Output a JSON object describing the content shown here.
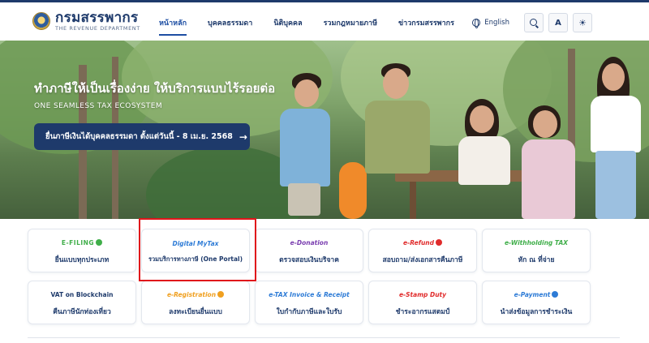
{
  "header": {
    "logo_th": "กรมสรรพากร",
    "logo_en": "THE REVENUE DEPARTMENT",
    "nav": [
      {
        "label": "หน้าหลัก",
        "active": true
      },
      {
        "label": "บุคคลธรรมดา",
        "active": false
      },
      {
        "label": "นิติบุคคล",
        "active": false
      },
      {
        "label": "รวมกฎหมายภาษี",
        "active": false
      },
      {
        "label": "ข่าวกรมสรรพากร",
        "active": false
      }
    ],
    "language": "English",
    "font_size_button": "A",
    "icons": {
      "language": "globe-icon",
      "search": "search-icon",
      "theme": "sun-icon"
    }
  },
  "hero": {
    "title": "ทำภาษีให้เป็นเรื่องง่าย ให้บริการแบบไร้รอยต่อ",
    "subtitle": "ONE SEAMLESS TAX ECOSYSTEM",
    "cta": "ยื่นภาษีเงินได้บุคคลธรรมดา ตั้งแต่วันนี้ - 8 เม.ย. 2568"
  },
  "services": [
    {
      "logo": "E-FILING",
      "label": "ยื่นแบบทุกประเภท",
      "accent": "#3fae49"
    },
    {
      "logo": "Digital MyTax",
      "label": "รวมบริการทางภาษี (One Portal)",
      "accent": "#2d7bd6",
      "highlighted": true
    },
    {
      "logo": "e-Donation",
      "label": "ตรวจสอบเงินบริจาค",
      "accent": "#7b3fb0"
    },
    {
      "logo": "e-Refund",
      "label": "สอบถาม/ส่งเอกสารคืนภาษี",
      "accent": "#e02b2b"
    },
    {
      "logo": "e-Withholding TAX",
      "label": "หัก ณ ที่จ่าย",
      "accent": "#3fae49"
    },
    {
      "logo": "VAT on Blockchain",
      "label": "คืนภาษีนักท่องเที่ยว",
      "accent": "#1e3a6b"
    },
    {
      "logo": "e-Registration",
      "label": "ลงทะเบียนยื่นแบบ",
      "accent": "#f0a020"
    },
    {
      "logo": "e-TAX Invoice & Receipt",
      "label": "ใบกำกับภาษีและใบรับ",
      "accent": "#2d7bd6"
    },
    {
      "logo": "e-Stamp Duty",
      "label": "ชำระอากรแสตมป์",
      "accent": "#e02b2b"
    },
    {
      "logo": "e-Payment",
      "label": "นำส่งข้อมูลการชำระเงิน",
      "accent": "#2d7bd6"
    }
  ]
}
